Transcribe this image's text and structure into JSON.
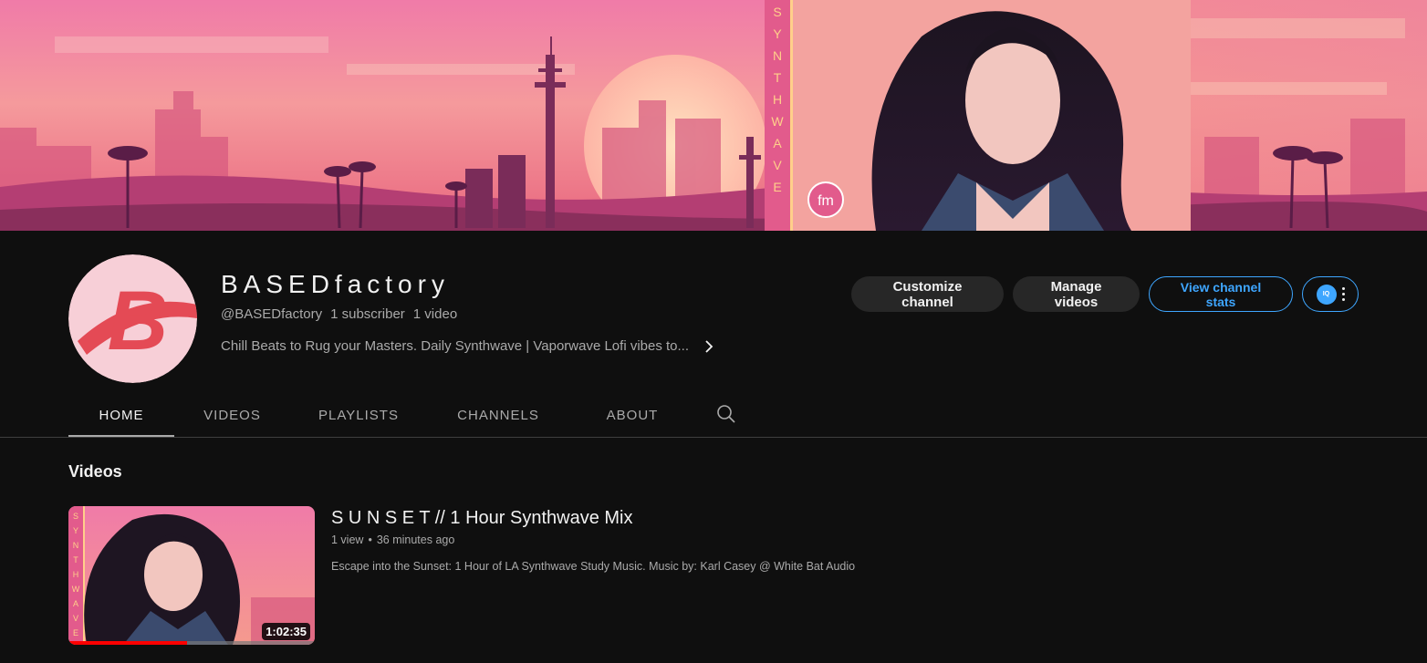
{
  "banner": {
    "vertical_text": [
      "S",
      "Y",
      "N",
      "T",
      "H",
      "W",
      "A",
      "V",
      "E"
    ],
    "logo_text": "fm"
  },
  "channel": {
    "name": "BASEDfactory",
    "handle": "@BASEDfactory",
    "subscribers": "1 subscriber",
    "videos_count": "1 video",
    "description": "Chill Beats to Rug your Masters. Daily Synthwave | Vaporwave Lofi vibes to...",
    "avatar_letter": "B"
  },
  "actions": {
    "customize": "Customize channel",
    "manage": "Manage videos",
    "stats": "View channel stats",
    "extension_label": "IQ"
  },
  "tabs": [
    {
      "label": "HOME",
      "active": true
    },
    {
      "label": "VIDEOS",
      "active": false
    },
    {
      "label": "PLAYLISTS",
      "active": false
    },
    {
      "label": "CHANNELS",
      "active": false
    },
    {
      "label": "ABOUT",
      "active": false
    }
  ],
  "section": {
    "title": "Videos"
  },
  "video": {
    "title": "S U N S E T // 1 Hour Synthwave Mix",
    "views": "1 view",
    "separator": "•",
    "age": "36 minutes ago",
    "description": "Escape into the Sunset: 1 Hour of LA Synthwave Study Music. Music by: Karl Casey @ White Bat Audio",
    "duration": "1:02:35",
    "watch_progress": 0.48,
    "thumb_vertical_text": [
      "S",
      "Y",
      "N",
      "T",
      "H",
      "W",
      "A",
      "V",
      "E"
    ]
  },
  "colors": {
    "background": "#0f0f0f",
    "accent_blue": "#3ea6ff",
    "button_dark": "#272727",
    "progress_red": "#ff0000"
  }
}
